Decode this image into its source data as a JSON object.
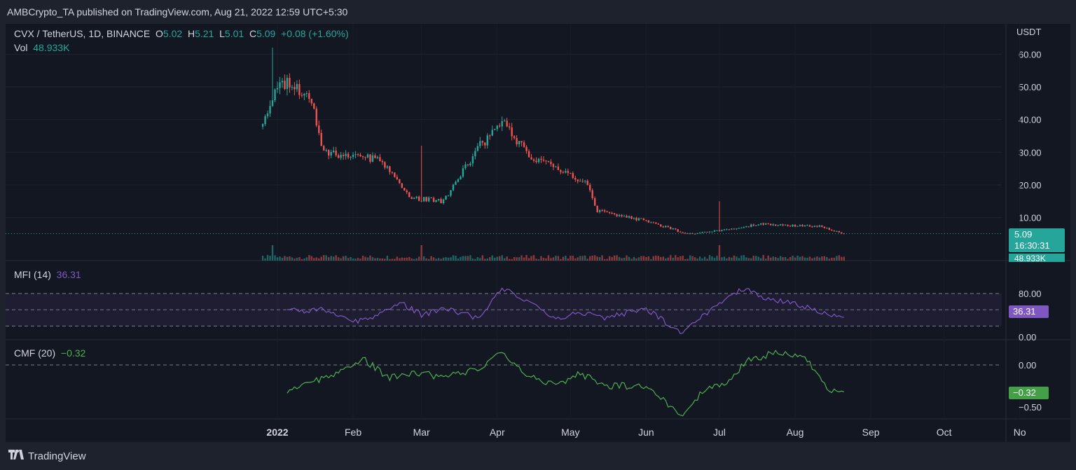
{
  "header": {
    "publish_text": "AMBCrypto_TA published on TradingView.com, Aug 21, 2022 12:59 UTC+5:30"
  },
  "legend": {
    "symbol": "CVX / TetherUS, 1D, BINANCE",
    "o_label": "O",
    "o_value": "5.02",
    "h_label": "H",
    "h_value": "5.21",
    "l_label": "L",
    "l_value": "5.01",
    "c_label": "C",
    "c_value": "5.09",
    "change": "+0.08 (+1.60%)",
    "vol_label": "Vol",
    "vol_value": "48.933K"
  },
  "price_axis": {
    "currency": "USDT",
    "ticks": [
      "60.00",
      "50.00",
      "40.00",
      "30.00",
      "20.00",
      "10.00"
    ],
    "last_price": "5.09",
    "countdown": "16:30:31",
    "volume_tag": "48.933K"
  },
  "mfi": {
    "label": "MFI (14)",
    "value": "36.31",
    "ticks": [
      "80.00",
      "0.00"
    ],
    "badge": "36.31"
  },
  "cmf": {
    "label": "CMF (20)",
    "value": "−0.32",
    "ticks": [
      "0.00",
      "−0.50"
    ],
    "badge": "−0.32"
  },
  "time_axis": [
    "2022",
    "Feb",
    "Mar",
    "Apr",
    "May",
    "Jun",
    "Jul",
    "Aug",
    "Sep",
    "Oct",
    "No"
  ],
  "footer": {
    "brand": "TradingView",
    "logo_icon": "tradingview-logo-icon"
  },
  "colors": {
    "up": "#26a69a",
    "down": "#ef5350",
    "mfi": "#7e57c2",
    "cmf": "#4caf50",
    "bg": "#131722"
  },
  "chart_data": [
    {
      "type": "candlestick",
      "title": "CVX / TetherUS, 1D, BINANCE",
      "ylabel": "USDT",
      "ylim": [
        0,
        65
      ],
      "x_range": [
        "2021-12-26",
        "2022-08-21"
      ],
      "key_points": [
        {
          "date": "2021-12-26",
          "close": 40
        },
        {
          "date": "2021-12-30",
          "high": 62
        },
        {
          "date": "2022-01-02",
          "close": 52
        },
        {
          "date": "2022-01-15",
          "close": 46
        },
        {
          "date": "2022-01-20",
          "close": 30
        },
        {
          "date": "2022-02-01",
          "close": 29
        },
        {
          "date": "2022-02-12",
          "close": 28
        },
        {
          "date": "2022-02-25",
          "close": 16
        },
        {
          "date": "2022-03-01",
          "high": 32
        },
        {
          "date": "2022-03-10",
          "close": 15
        },
        {
          "date": "2022-03-25",
          "close": 32
        },
        {
          "date": "2022-04-03",
          "close": 39
        },
        {
          "date": "2022-04-15",
          "close": 28
        },
        {
          "date": "2022-04-30",
          "close": 24
        },
        {
          "date": "2022-05-08",
          "close": 20
        },
        {
          "date": "2022-05-12",
          "close": 12
        },
        {
          "date": "2022-06-01",
          "close": 9
        },
        {
          "date": "2022-06-18",
          "close": 5
        },
        {
          "date": "2022-07-01",
          "high": 15
        },
        {
          "date": "2022-07-01",
          "close": 6
        },
        {
          "date": "2022-07-18",
          "close": 8
        },
        {
          "date": "2022-08-01",
          "close": 7.5
        },
        {
          "date": "2022-08-10",
          "close": 7.5
        },
        {
          "date": "2022-08-21",
          "close": 5.09
        }
      ],
      "last": {
        "open": 5.02,
        "high": 5.21,
        "low": 5.01,
        "close": 5.09,
        "change": 0.08,
        "change_pct": 1.6
      }
    },
    {
      "type": "line",
      "title": "MFI (14)",
      "ylim": [
        0,
        100
      ],
      "bands": [
        20,
        50,
        80
      ],
      "x": [
        "2022-01-05",
        "2022-01-12",
        "2022-01-20",
        "2022-02-01",
        "2022-02-10",
        "2022-02-20",
        "2022-03-01",
        "2022-03-10",
        "2022-03-25",
        "2022-04-03",
        "2022-04-15",
        "2022-04-25",
        "2022-05-05",
        "2022-05-15",
        "2022-06-01",
        "2022-06-15",
        "2022-06-25",
        "2022-07-05",
        "2022-07-12",
        "2022-07-20",
        "2022-08-01",
        "2022-08-10",
        "2022-08-21"
      ],
      "values": [
        52,
        48,
        52,
        28,
        38,
        65,
        40,
        52,
        34,
        90,
        60,
        35,
        44,
        35,
        52,
        8,
        40,
        78,
        88,
        70,
        62,
        47,
        36.31
      ]
    },
    {
      "type": "line",
      "title": "CMF (20)",
      "ylim": [
        -0.6,
        0.25
      ],
      "x": [
        "2022-01-05",
        "2022-01-15",
        "2022-01-25",
        "2022-02-05",
        "2022-02-15",
        "2022-03-01",
        "2022-03-10",
        "2022-03-25",
        "2022-04-03",
        "2022-04-15",
        "2022-04-25",
        "2022-05-05",
        "2022-05-15",
        "2022-06-01",
        "2022-06-15",
        "2022-06-25",
        "2022-07-05",
        "2022-07-12",
        "2022-07-25",
        "2022-08-05",
        "2022-08-15",
        "2022-08-21"
      ],
      "values": [
        -0.3,
        -0.2,
        -0.1,
        0.08,
        -0.15,
        -0.1,
        -0.15,
        -0.05,
        0.15,
        -0.15,
        -0.25,
        -0.1,
        -0.25,
        -0.25,
        -0.6,
        -0.3,
        -0.2,
        0.05,
        0.15,
        0.1,
        -0.3,
        -0.32
      ]
    }
  ]
}
